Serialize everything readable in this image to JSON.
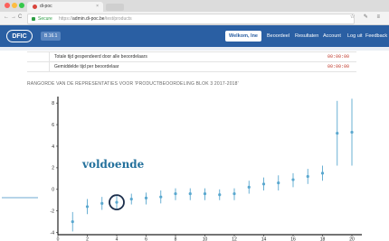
{
  "browser": {
    "tab_title": "di-poc",
    "tab_close": "×",
    "secure_label": "Secure",
    "url_prefix": "https://",
    "url_host": "admin.di-poc.be",
    "url_path": "/test/products",
    "nav_back": "←",
    "nav_forward": "→",
    "nav_reload": "C",
    "right_icons": "☆ ✎ ≡"
  },
  "app": {
    "logo": "DFIC",
    "product_badge": "B.16.1",
    "welcome": "Welkom, Ine",
    "nav": [
      "Beoordeel",
      "Resultaten",
      "Account",
      "Log uit",
      "Feedback"
    ]
  },
  "table": {
    "rows": [
      {
        "label": "Totale tijd gespendeerd door alle beoordelaars",
        "value": "00:00:00"
      },
      {
        "label": "Gemiddelde tijd per beoordelaar",
        "value": "00:00:00"
      }
    ]
  },
  "chart_title": "RANGORDE VAN DE REPRESENTATIES VOOR 'PRODUCTBEOORDELING BLOK 3 2017-2018'",
  "annotation": "voldoende",
  "colors": {
    "accent": "#2a5fa3",
    "points": "#5aa8cf",
    "circle": "#1a2d4a",
    "annotation": "#24719c"
  },
  "chart_data": {
    "type": "scatter",
    "title": "RANGORDE VAN DE REPRESENTATIES VOOR 'PRODUCTBEOORDELING BLOK 3 2017-2018'",
    "xlabel": "",
    "ylabel": "",
    "xlim": [
      0,
      20.5
    ],
    "ylim": [
      -4.2,
      8.6
    ],
    "xticks": [
      0,
      2,
      4,
      6,
      8,
      10,
      12,
      14,
      16,
      18,
      20
    ],
    "yticks": [
      -4,
      -2,
      0,
      2,
      4,
      6,
      8
    ],
    "highlighted_x": 4,
    "points": [
      {
        "x": 1,
        "y": -3.0,
        "lo": -3.9,
        "hi": -2.1
      },
      {
        "x": 2,
        "y": -1.6,
        "lo": -2.3,
        "hi": -0.9
      },
      {
        "x": 3,
        "y": -1.3,
        "lo": -1.9,
        "hi": -0.7
      },
      {
        "x": 4,
        "y": -1.2,
        "lo": -1.8,
        "hi": -0.6
      },
      {
        "x": 5,
        "y": -0.9,
        "lo": -1.4,
        "hi": -0.4
      },
      {
        "x": 6,
        "y": -0.8,
        "lo": -1.4,
        "hi": -0.3
      },
      {
        "x": 7,
        "y": -0.7,
        "lo": -1.3,
        "hi": -0.1
      },
      {
        "x": 8,
        "y": -0.4,
        "lo": -1.0,
        "hi": 0.1
      },
      {
        "x": 9,
        "y": -0.4,
        "lo": -1.0,
        "hi": 0.1
      },
      {
        "x": 10,
        "y": -0.4,
        "lo": -1.0,
        "hi": 0.1
      },
      {
        "x": 11,
        "y": -0.5,
        "lo": -1.0,
        "hi": 0.0
      },
      {
        "x": 12,
        "y": -0.4,
        "lo": -1.0,
        "hi": 0.1
      },
      {
        "x": 13,
        "y": 0.2,
        "lo": -0.4,
        "hi": 0.8
      },
      {
        "x": 14,
        "y": 0.5,
        "lo": -0.1,
        "hi": 1.1
      },
      {
        "x": 15,
        "y": 0.6,
        "lo": -0.1,
        "hi": 1.3
      },
      {
        "x": 16,
        "y": 0.9,
        "lo": 0.2,
        "hi": 1.5
      },
      {
        "x": 17,
        "y": 1.2,
        "lo": 0.5,
        "hi": 1.9
      },
      {
        "x": 18,
        "y": 1.5,
        "lo": 0.8,
        "hi": 2.2
      },
      {
        "x": 19,
        "y": 5.2,
        "lo": 2.2,
        "hi": 8.2
      },
      {
        "x": 20,
        "y": 5.3,
        "lo": 2.2,
        "hi": 8.4
      }
    ]
  }
}
